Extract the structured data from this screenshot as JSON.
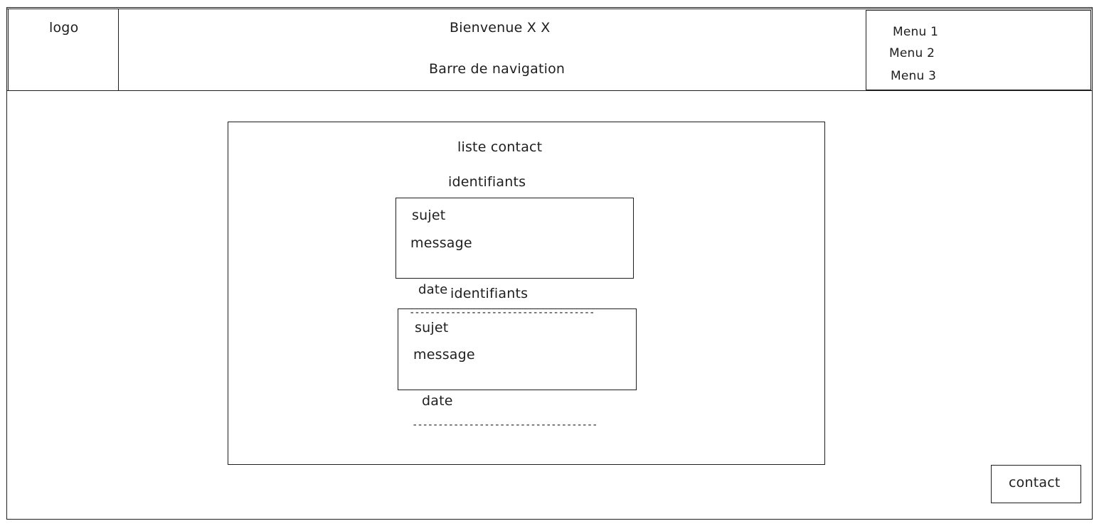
{
  "header": {
    "logo": "logo",
    "welcome": "Bienvenue X X",
    "nav_label": "Barre de navigation",
    "menu": [
      "Menu 1",
      "Menu 2",
      "Menu 3"
    ]
  },
  "panel": {
    "title": "liste contact",
    "entries": [
      {
        "identifiants": "identifiants",
        "sujet": "sujet",
        "message": "message",
        "date": "date",
        "separator": "------------------------------------"
      },
      {
        "identifiants": "identifiants",
        "sujet": "sujet",
        "message": "message",
        "date": "date",
        "separator": "------------------------------------"
      }
    ]
  },
  "footer": {
    "contact_button": "contact"
  }
}
